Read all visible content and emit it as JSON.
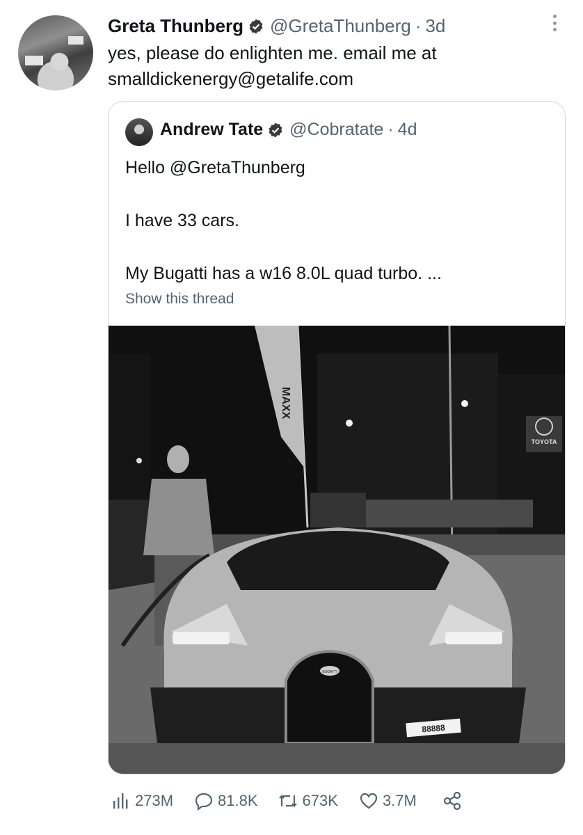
{
  "tweet": {
    "author_name": "Greta Thunberg",
    "author_handle": "@GretaThunberg",
    "separator": "·",
    "time": "3d",
    "text_line1": "yes, please do enlighten me. email me at",
    "text_line2": "smalldickenergy@getalife.com"
  },
  "quoted": {
    "author_name": "Andrew Tate",
    "author_handle": "@Cobratate",
    "separator": "·",
    "time": "4d",
    "line1": "Hello @GretaThunberg",
    "line2": "I have 33 cars.",
    "line3": "My Bugatti has a w16 8.0L quad turbo. ...",
    "show_thread": "Show this thread",
    "photo_text": {
      "flag_brand": "MAXX",
      "dealer_sign": "TOYOTA",
      "badge": "BUGATTI",
      "plate": "88888"
    }
  },
  "stats": {
    "views": "273M",
    "replies": "81.8K",
    "retweets": "673K",
    "likes": "3.7M"
  },
  "icons": {
    "verified": "verified-badge-icon",
    "more": "more-icon",
    "views": "views-icon",
    "reply": "reply-icon",
    "retweet": "retweet-icon",
    "like": "like-icon",
    "share": "share-icon"
  },
  "colors": {
    "text_primary": "#0f1419",
    "text_secondary": "#536471",
    "border": "#cfd9de"
  }
}
